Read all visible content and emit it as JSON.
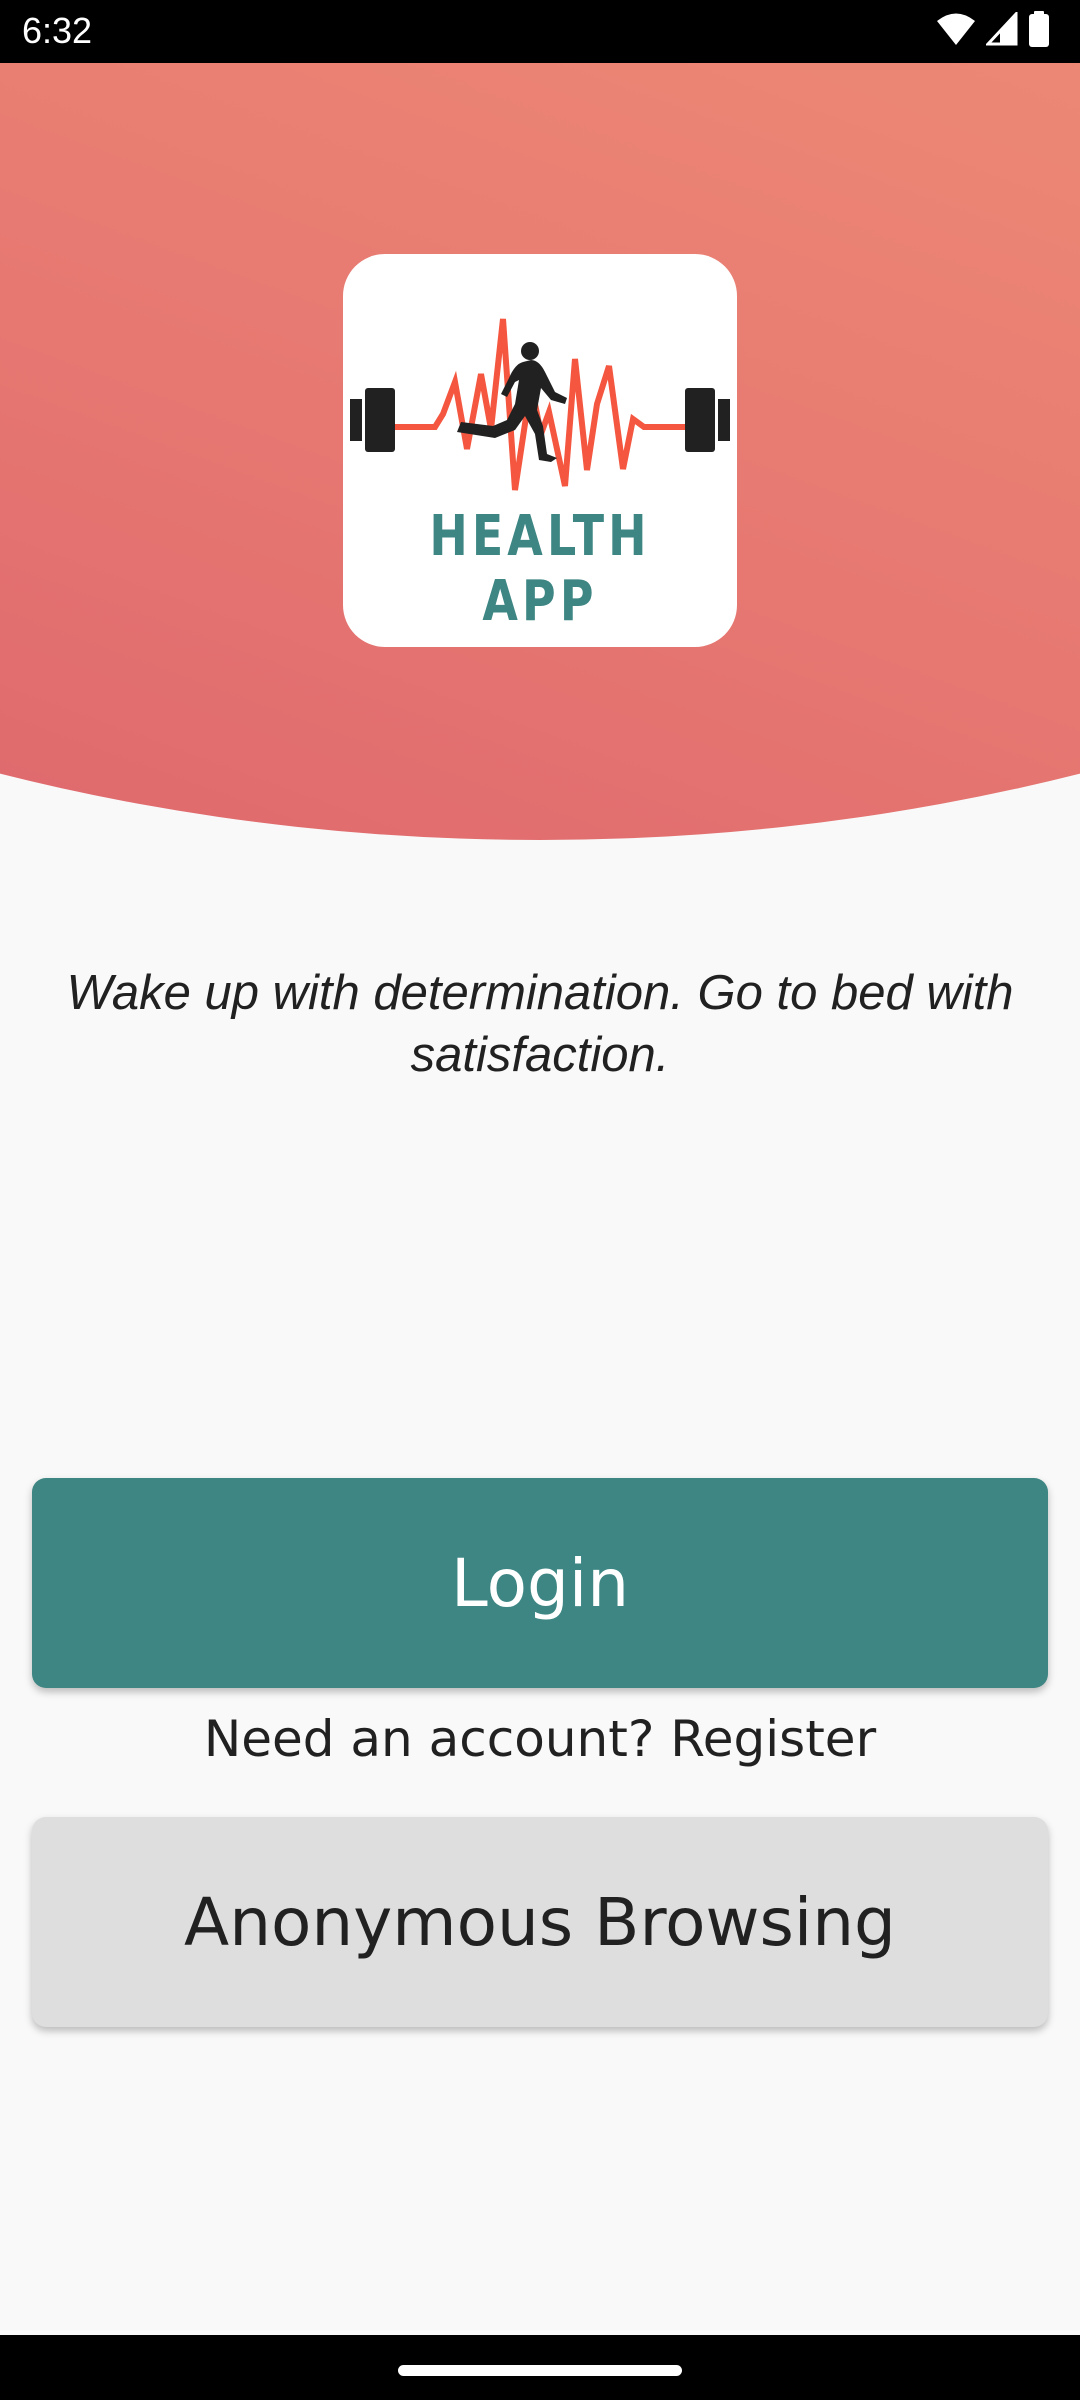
{
  "status_bar": {
    "time": "6:32",
    "icons": [
      "wifi-icon",
      "signal-icon",
      "battery-icon"
    ]
  },
  "logo": {
    "text": "HEALTH APP",
    "icon": "barbell-heartbeat-runner-icon"
  },
  "quote": "Wake up with determination. Go to bed with satisfaction.",
  "buttons": {
    "login_label": "Login",
    "register_label": "Need an account? Register",
    "anonymous_label": "Anonymous Browsing"
  },
  "colors": {
    "primary": "#3d8683",
    "secondary_button": "#dedede",
    "header_gradient_start": "#f9ab88",
    "header_gradient_end": "#e06a6e",
    "logo_pulse": "#f4563f",
    "background": "#f9f9f9"
  },
  "nav_bar": {
    "gesture_handle": "home-handle"
  }
}
